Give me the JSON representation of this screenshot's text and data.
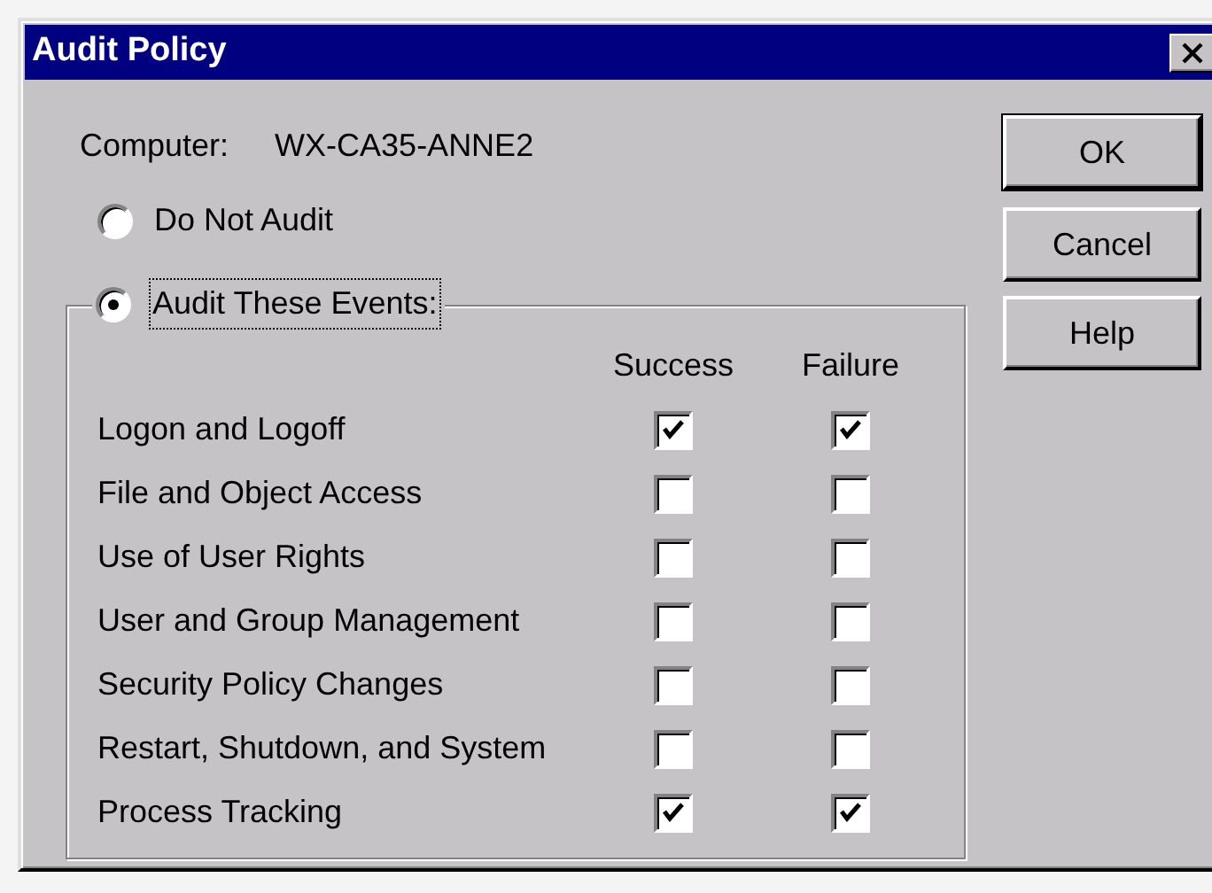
{
  "window": {
    "title": "Audit Policy"
  },
  "computer": {
    "label": "Computer:",
    "value": "WX-CA35-ANNE2"
  },
  "audit_options": [
    {
      "label": "Do Not Audit",
      "selected": false,
      "focused": false
    },
    {
      "label": "Audit These Events:",
      "selected": true,
      "focused": true
    }
  ],
  "events": {
    "columns": [
      "Success",
      "Failure"
    ],
    "rows": [
      {
        "label": "Logon and Logoff",
        "success": true,
        "failure": true
      },
      {
        "label": "File and Object Access",
        "success": false,
        "failure": false
      },
      {
        "label": "Use of User Rights",
        "success": false,
        "failure": false
      },
      {
        "label": "User and Group Management",
        "success": false,
        "failure": false
      },
      {
        "label": "Security Policy Changes",
        "success": false,
        "failure": false
      },
      {
        "label": "Restart, Shutdown, and System",
        "success": false,
        "failure": false
      },
      {
        "label": "Process Tracking",
        "success": true,
        "failure": true
      }
    ]
  },
  "buttons": [
    {
      "label": "OK",
      "default": true
    },
    {
      "label": "Cancel",
      "default": false
    },
    {
      "label": "Help",
      "default": false
    }
  ]
}
